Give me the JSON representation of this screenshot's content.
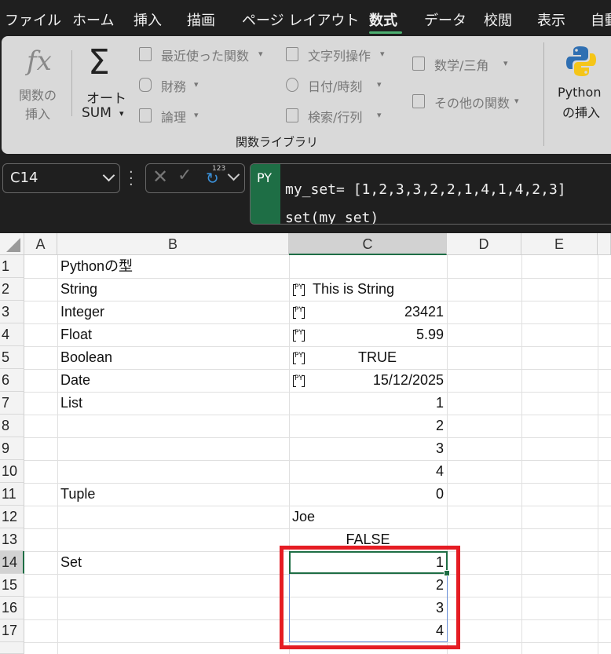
{
  "menu": {
    "tabs": [
      "ファイル",
      "ホーム",
      "挿入",
      "描画",
      "ページ レイアウト",
      "数式",
      "データ",
      "校閲",
      "表示",
      "自動"
    ],
    "active": "数式"
  },
  "ribbon": {
    "insert_function": {
      "icon": "fx",
      "line1": "関数の",
      "line2": "挿入"
    },
    "autosum": {
      "line1": "オート",
      "line2": "SUM"
    },
    "recent": "最近使った関数",
    "financial": "財務",
    "logical": "論理",
    "text": "文字列操作",
    "datetime": "日付/時刻",
    "lookup": "検索/行列",
    "math": "数学/三角",
    "more": "その他の関数",
    "python": {
      "line1": "Python",
      "line2": "の挿入"
    },
    "group_label": "関数ライブラリ"
  },
  "formula_bar": {
    "name_box": "C14",
    "py_tag": "PY",
    "line1": "my_set= [1,2,3,3,2,2,1,4,1,4,2,3]",
    "line2": "set(my_set)",
    "superscript": "123"
  },
  "grid": {
    "columns": [
      "A",
      "B",
      "C",
      "D",
      "E"
    ],
    "rows": [
      "1",
      "2",
      "3",
      "4",
      "5",
      "6",
      "7",
      "8",
      "9",
      "10",
      "11",
      "12",
      "13",
      "14",
      "15",
      "16",
      "17"
    ],
    "py_badge": "PY",
    "cells": {
      "b1": "Pythonの型",
      "b2": "String",
      "b3": "Integer",
      "b4": "Float",
      "b5": "Boolean",
      "b6": "Date",
      "b7": "List",
      "b11": "Tuple",
      "b14": "Set",
      "c2": "This is String",
      "c3": "23421",
      "c4": "5.99",
      "c5": "TRUE",
      "c6": "15/12/2025",
      "c7": "1",
      "c8": "2",
      "c9": "3",
      "c10": "4",
      "c11": "0",
      "c12": "Joe",
      "c13": "FALSE",
      "c14": "1",
      "c15": "2",
      "c16": "3",
      "c17": "4"
    }
  },
  "colors": {
    "accent": "#1e6e45",
    "highlight_box": "#e51c23",
    "spill_border": "#6a8fd6"
  }
}
